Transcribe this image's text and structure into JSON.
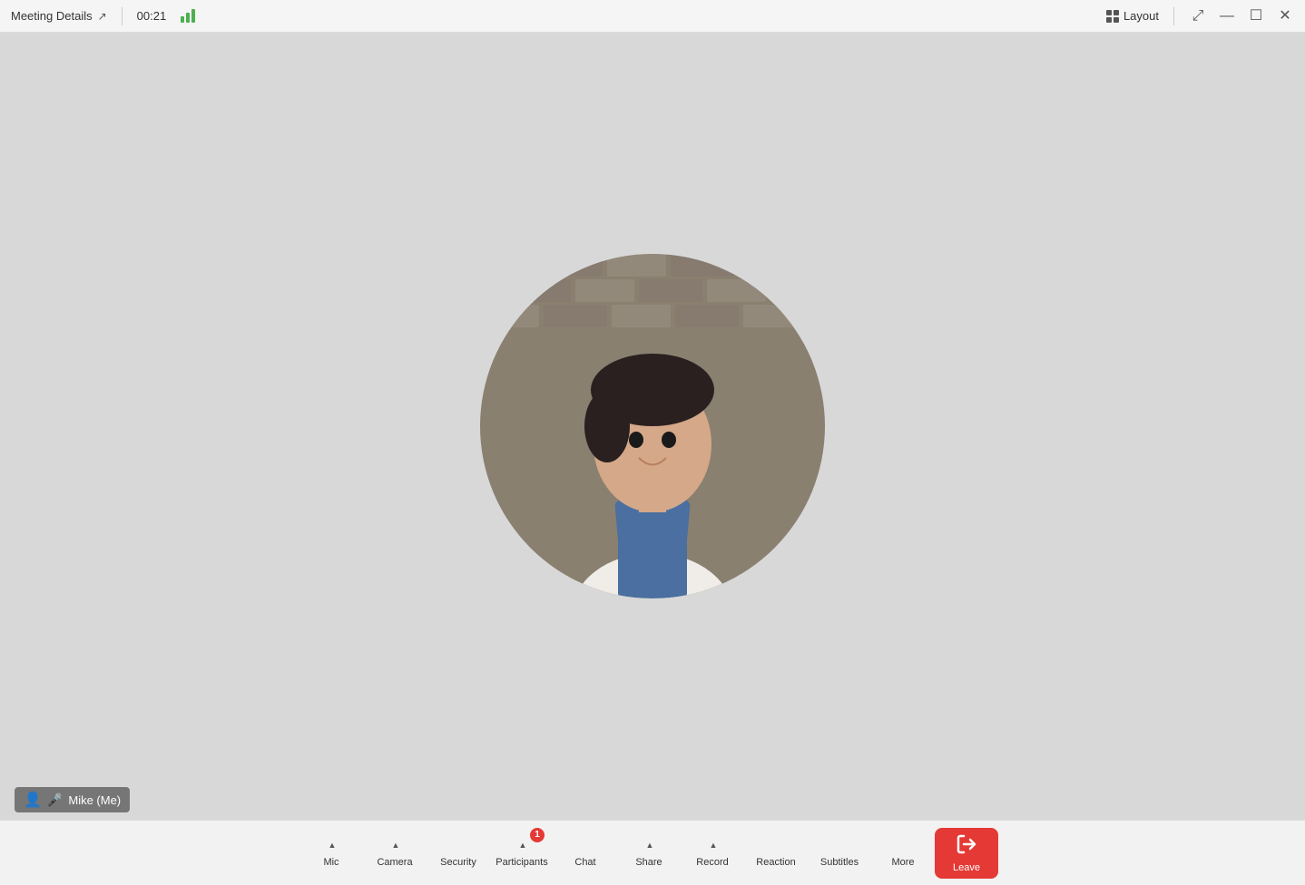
{
  "titleBar": {
    "meetingDetails": "Meeting Details",
    "timer": "00:21",
    "layout": "Layout",
    "shareIcon": "↗"
  },
  "personLabel": {
    "name": "Mike (Me)"
  },
  "toolbar": {
    "mic": "Mic",
    "camera": "Camera",
    "security": "Security",
    "participants": "Participants",
    "participantsBadge": "1",
    "chat": "Chat",
    "share": "Share",
    "record": "Record",
    "reaction": "Reaction",
    "subtitles": "Subtitles",
    "more": "More",
    "leave": "Leave"
  }
}
